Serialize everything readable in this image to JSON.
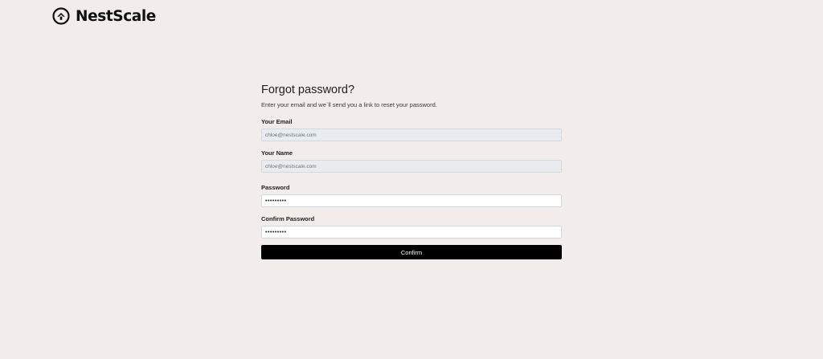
{
  "brand": {
    "name": "NestScale"
  },
  "form": {
    "title": "Forgot password?",
    "subtitle": "Enter your email and we`ll send you a link to reset your password.",
    "email_label": "Your Email",
    "email_value": "chloe@nestscale.com",
    "name_label": "Your Name",
    "name_value": "chloe@nestscale.com",
    "password_label": "Password",
    "password_value": "•••••••••",
    "confirm_password_label": "Confirm Password",
    "confirm_password_value": "•••••••••",
    "confirm_button": "Confirm"
  }
}
